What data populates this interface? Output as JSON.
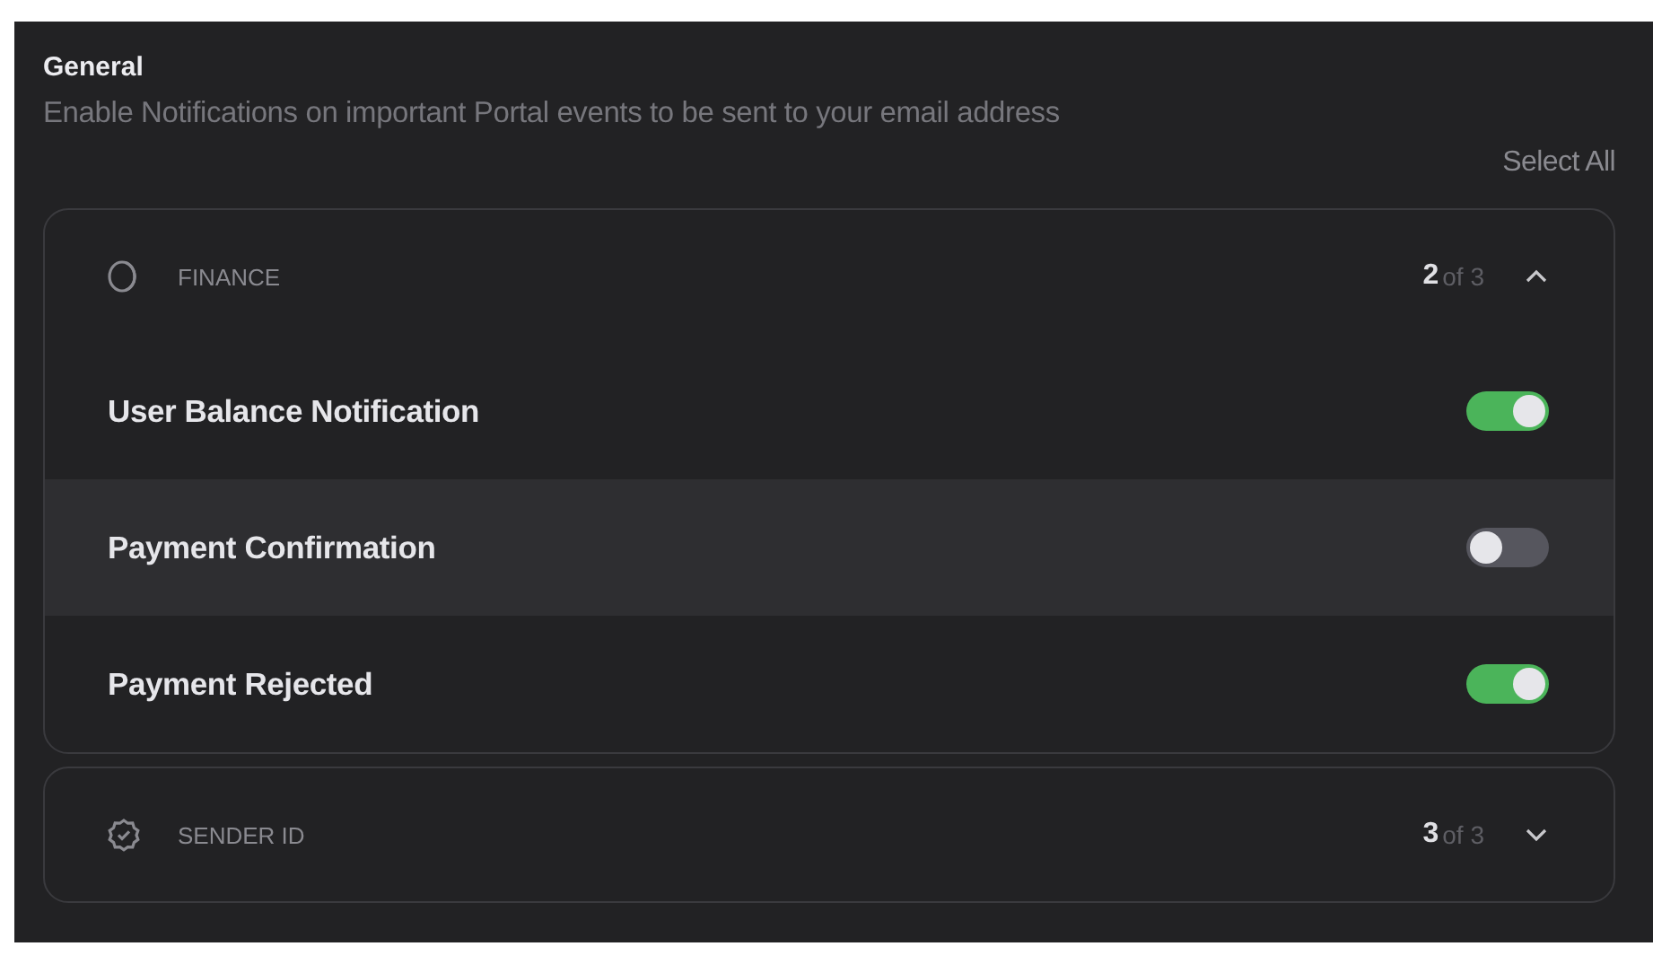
{
  "section": {
    "title": "General",
    "description": "Enable Notifications on important Portal events to be sent to your email address",
    "select_all": "Select All"
  },
  "groups": [
    {
      "kind": "coin",
      "name": "FINANCE",
      "count": "2",
      "total": "of 3",
      "expanded": true,
      "items": [
        {
          "label": "User Balance Notification",
          "on": true,
          "highlighted": false
        },
        {
          "label": "Payment Confirmation",
          "on": false,
          "highlighted": true
        },
        {
          "label": "Payment Rejected",
          "on": true,
          "highlighted": false
        }
      ]
    },
    {
      "kind": "badge",
      "name": "SENDER ID",
      "count": "3",
      "total": "of 3",
      "expanded": false
    }
  ]
}
